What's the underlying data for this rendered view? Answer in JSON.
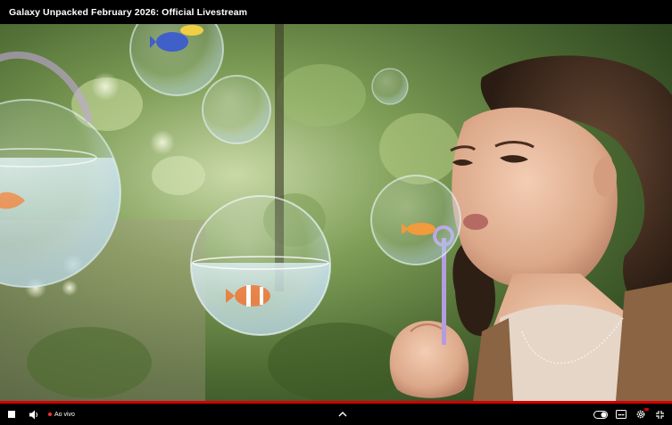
{
  "window": {
    "title": "Galaxy Unpacked February 2026: Official Livestream"
  },
  "player": {
    "live_label": "Ao vivo",
    "progress_fraction": 1.0,
    "accent_color": "#d40000",
    "live_dot_color": "#ff3030"
  },
  "icons": {
    "stop": "stop-icon",
    "volume": "volume-icon",
    "expand": "chevron-up-icon",
    "autoplay": "autoplay-toggle-icon",
    "captions": "captions-icon",
    "settings": "settings-icon",
    "exit_fullscreen": "exit-fullscreen-icon",
    "like": "thumbs-up-icon",
    "dislike": "thumbs-down-icon",
    "share": "share-icon"
  }
}
